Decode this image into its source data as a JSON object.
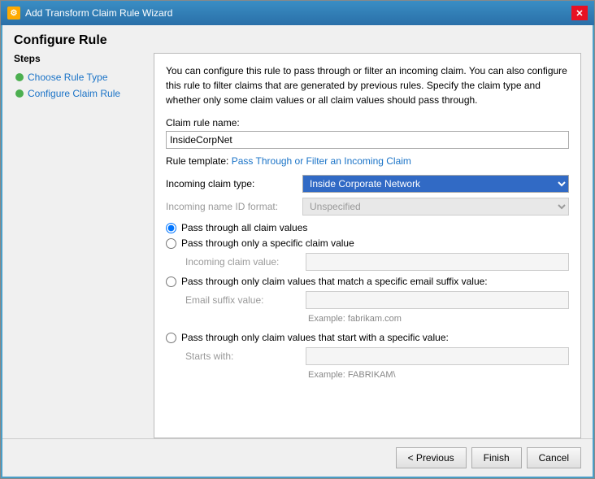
{
  "window": {
    "title": "Add Transform Claim Rule Wizard",
    "icon": "⚙",
    "close_label": "✕"
  },
  "page": {
    "title": "Configure Rule"
  },
  "sidebar": {
    "steps_label": "Steps",
    "items": [
      {
        "label": "Choose Rule Type",
        "active": true
      },
      {
        "label": "Configure Claim Rule",
        "active": true
      }
    ]
  },
  "content": {
    "description": "You can configure this rule to pass through or filter an incoming claim. You can also configure this rule to filter claims that are generated by previous rules. Specify the claim type and whether only some claim values or all claim values should pass through.",
    "claim_rule_name_label": "Claim rule name:",
    "claim_rule_name_value": "InsideCorpNet",
    "rule_template_prefix": "Rule template: ",
    "rule_template_link": "Pass Through or Filter an Incoming Claim",
    "incoming_claim_type_label": "Incoming claim type:",
    "incoming_claim_type_value": "Inside Corporate Network",
    "incoming_name_id_label": "Incoming name ID format:",
    "incoming_name_id_value": "Unspecified",
    "radio_options": [
      {
        "id": "radio1",
        "label": "Pass through all claim values",
        "checked": true,
        "disabled": false
      },
      {
        "id": "radio2",
        "label": "Pass through only a specific claim value",
        "checked": false,
        "disabled": false
      },
      {
        "id": "radio3",
        "label": "Pass through only claim values that match a specific email suffix value:",
        "checked": false,
        "disabled": false
      },
      {
        "id": "radio4",
        "label": "Pass through only claim values that start with a specific value:",
        "checked": false,
        "disabled": false
      }
    ],
    "incoming_claim_value_label": "Incoming claim value:",
    "email_suffix_label": "Email suffix value:",
    "email_example": "Example: fabrikam.com",
    "starts_with_label": "Starts with:",
    "starts_with_example": "Example: FABRIKAM\\"
  },
  "buttons": {
    "previous_label": "< Previous",
    "finish_label": "Finish",
    "cancel_label": "Cancel"
  }
}
